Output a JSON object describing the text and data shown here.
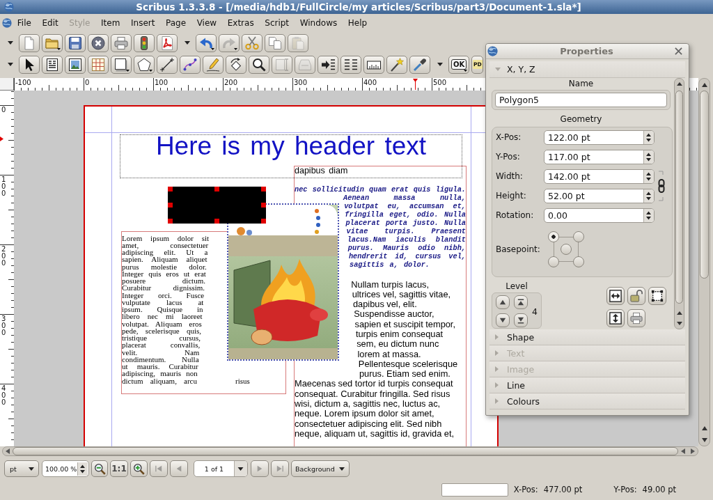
{
  "window": {
    "title": "Scribus 1.3.3.8 - [/media/hdb1/FullCircle/my articles/Scribus/part3/Document-1.sla*]"
  },
  "menu": [
    {
      "label": "File",
      "disabled": false
    },
    {
      "label": "Edit",
      "disabled": false
    },
    {
      "label": "Style",
      "disabled": true
    },
    {
      "label": "Item",
      "disabled": false
    },
    {
      "label": "Insert",
      "disabled": false
    },
    {
      "label": "Page",
      "disabled": false
    },
    {
      "label": "View",
      "disabled": false
    },
    {
      "label": "Extras",
      "disabled": false
    },
    {
      "label": "Script",
      "disabled": false
    },
    {
      "label": "Windows",
      "disabled": false
    },
    {
      "label": "Help",
      "disabled": false
    }
  ],
  "toolbars": [
    {
      "groups": [
        [
          {
            "disabled": false,
            "dropdown": false
          },
          {
            "disabled": false,
            "dropdown": true
          },
          {
            "disabled": false,
            "dropdown": false
          },
          {
            "disabled": false,
            "dropdown": false
          },
          {
            "disabled": false,
            "dropdown": false
          },
          {
            "disabled": false,
            "dropdown": false
          },
          {
            "disabled": false,
            "dropdown": false
          }
        ],
        [
          {
            "disabled": false,
            "dropdown": true
          },
          {
            "disabled": true,
            "dropdown": true
          },
          {
            "disabled": false,
            "dropdown": false
          },
          {
            "disabled": false,
            "dropdown": false
          },
          {
            "disabled": true,
            "dropdown": false
          }
        ]
      ]
    },
    {
      "groups": [
        [
          {
            "disabled": false,
            "dropdown": false
          },
          {
            "disabled": false,
            "dropdown": false
          },
          {
            "disabled": false,
            "dropdown": false
          },
          {
            "disabled": false,
            "dropdown": false
          },
          {
            "disabled": false,
            "dropdown": true
          },
          {
            "disabled": false,
            "dropdown": true
          },
          {
            "disabled": false,
            "dropdown": false
          },
          {
            "disabled": false,
            "dropdown": false
          },
          {
            "disabled": false,
            "dropdown": false
          },
          {
            "disabled": false,
            "dropdown": false
          },
          {
            "disabled": false,
            "dropdown": false
          },
          {
            "disabled": true,
            "dropdown": false
          },
          {
            "disabled": true,
            "dropdown": false
          },
          {
            "disabled": false,
            "dropdown": false
          },
          {
            "disabled": false,
            "dropdown": false
          },
          {
            "disabled": false,
            "dropdown": false
          },
          {
            "disabled": false,
            "dropdown": false
          },
          {
            "disabled": false,
            "dropdown": false
          }
        ],
        [
          {
            "label": "OK",
            "disabled": false,
            "dropdown": true
          },
          {
            "label": "PD",
            "disabled": false,
            "dropdown": false
          }
        ]
      ]
    }
  ],
  "rulers": {
    "horizontal": [
      "-100",
      "0",
      "100",
      "200",
      "300",
      "400",
      "500"
    ],
    "vertical": [
      "0",
      "100",
      "200",
      "300",
      "400"
    ]
  },
  "page": {
    "header": {
      "text": "Here is my header text"
    },
    "shape": {
      "selected": true
    },
    "left_frame": {
      "text": "Lorem ipsum dolor sit\namet, consectetuer\nadipiscing elit. Ut a\nsapien. Aliquam aliquet\npurus molestie dolor.\nInteger quis eros ut erat\nposuere dictum.\nCurabitur dignissim.\nInteger orci. Fusce\nvulputate lacus at\nipsum. Quisque in\nlibero nec mi laoreet\nvolutpat. Aliquam eros\npede, scelerisque quis,\ntristique cursus,\nplacerat convallis,\nvelit. Nam\ncondimentum. Nulla\nut mauris. Curabitur\nadipiscing, mauris non\ndictum aliquam, arcu",
      "overflow": "risus"
    },
    "right_frame": {
      "paragraphs": [
        {
          "kind": "plain",
          "text": "dapibus diam"
        },
        {
          "kind": "code",
          "text": "nec sollicitudin quam erat quis ligula.\nAenean massa nulla,\nvolutpat eu, accumsan et,\nfringilla eget, odio. Nulla\nplacerat porta justo. Nulla\nvitae turpis. Praesent\nlacus.Nam iaculis blandit\npurus. Mauris odio nibh,\nhendrerit id, cursus vel,\nsagittis a, dolor."
        },
        {
          "kind": "wrapped",
          "text": "Nullam turpis lacus,\nultrices vel, sagittis vitae,\ndapibus vel, elit.\nSuspendisse auctor,\nsapien et suscipit tempor,\nturpis enim consequat\nsem, eu dictum nunc\nlorem at massa.\nPellentesque scelerisque\npurus. Etiam sed enim.\nMaecenas sed tortor id turpis consequat\nconsequat. Curabitur fringilla. Sed risus\nwisi, dictum a, sagittis nec, luctus ac,\nneque. Lorem ipsum dolor sit amet,\nconsectetuer adipiscing elit. Sed nibh\nneque, aliquam ut, sagittis id, gravida et,"
        }
      ]
    }
  },
  "properties": {
    "title": "Properties",
    "sections": [
      {
        "label": "X, Y, Z",
        "expanded": true,
        "disabled": false
      },
      {
        "label": "Shape",
        "expanded": false,
        "disabled": false
      },
      {
        "label": "Text",
        "expanded": false,
        "disabled": true
      },
      {
        "label": "Image",
        "expanded": false,
        "disabled": true
      },
      {
        "label": "Line",
        "expanded": false,
        "disabled": false
      },
      {
        "label": "Colours",
        "expanded": false,
        "disabled": false
      }
    ],
    "name": {
      "label": "Name",
      "value": "Polygon5"
    },
    "geometry": {
      "label": "Geometry",
      "fields": [
        {
          "label": "X-Pos:",
          "value": "122.00 pt"
        },
        {
          "label": "Y-Pos:",
          "value": "117.00 pt"
        },
        {
          "label": "Width:",
          "value": "142.00 pt"
        },
        {
          "label": "Height:",
          "value": "52.00 pt"
        },
        {
          "label": "Rotation:",
          "value": "0.00"
        }
      ],
      "basepoint": {
        "label": "Basepoint:",
        "points": [
          {
            "selected": true
          },
          {
            "selected": false
          },
          {
            "selected": false
          },
          {
            "selected": false
          },
          {
            "selected": false
          }
        ]
      }
    },
    "level": {
      "label": "Level",
      "value": "4"
    }
  },
  "bottom_bar": {
    "unit": "pt",
    "zoom": "100.00 %",
    "actual_size": "1:1",
    "page_nav": [
      {
        "disabled": true
      },
      {
        "disabled": true
      },
      {
        "disabled": true
      },
      {
        "disabled": true
      }
    ],
    "page": "1 of 1",
    "layer": "Background"
  },
  "status_bar": {
    "x_label": "X-Pos:",
    "x_value": "477.00 pt",
    "y_label": "Y-Pos:",
    "y_value": "49.00 pt"
  }
}
